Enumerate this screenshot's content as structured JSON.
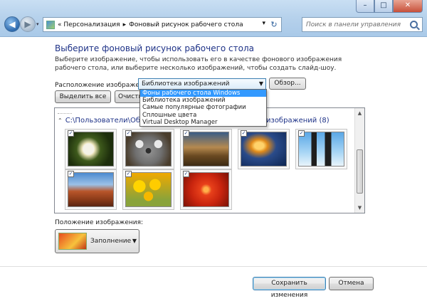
{
  "address": {
    "nav_dropdown": "▾",
    "prefix": "«",
    "crumb1": "Персонализация",
    "crumb_sep": "▸",
    "crumb2": "Фоновый рисунок рабочего стола",
    "refresh": "↻"
  },
  "search": {
    "placeholder": "Поиск в панели управления"
  },
  "window": {
    "minimize": "–",
    "maximize": "□",
    "close": "✕"
  },
  "page": {
    "title": "Выберите фоновый рисунок рабочего стола",
    "description": "Выберите изображение, чтобы использовать его в качестве фонового изображения рабочего стола, или выберите несколько изображений, чтобы создать слайд-шоу."
  },
  "location": {
    "label": "Расположение изображения:",
    "selected": "Библиотека изображений",
    "arrow": "▼",
    "browse": "Обзор...",
    "options": [
      "Фоны рабочего стола Windows",
      "Библиотека изображений",
      "Самые популярные фотографии",
      "Сплошные цвета",
      "Virtual Desktop Manager"
    ]
  },
  "actions": {
    "select_all": "Выделить все",
    "clear": "Очистить"
  },
  "gallery": {
    "chevron": "⌃",
    "path": "C:\\Пользователи\\Общ",
    "path_suffix": "изображений (8)",
    "scroll_up": "▲",
    "scroll_down": "▼",
    "check": "✓",
    "images": [
      "Хризантема",
      "Коала",
      "Маяк",
      "Медуза",
      "Пингвины",
      "Пустыня",
      "Тюльпаны",
      "Гортензия"
    ]
  },
  "position": {
    "label": "Положение изображения:",
    "selected": "Заполнение",
    "arrow": "▼"
  },
  "buttons": {
    "save": "Сохранить изменения",
    "cancel": "Отмена"
  }
}
